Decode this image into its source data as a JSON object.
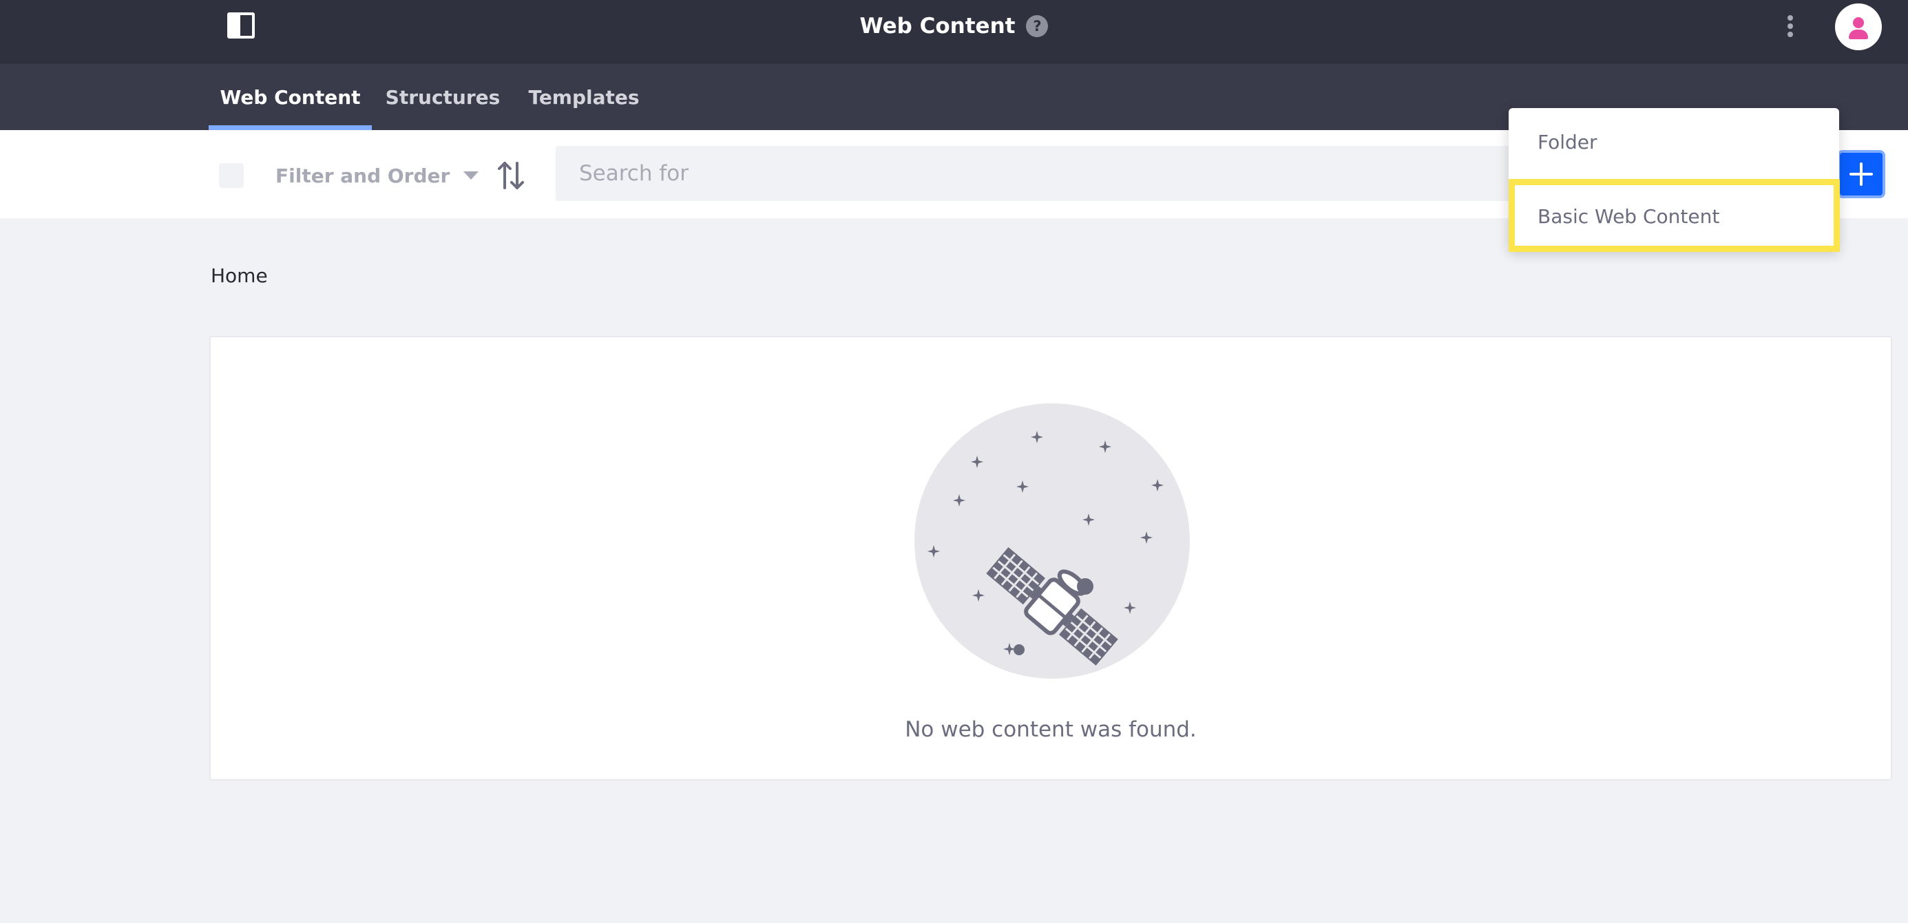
{
  "header": {
    "title": "Web Content",
    "help_glyph": "?",
    "sidebar_toggle_icon": "sidebar-toggle-icon",
    "options_icon": "kebab-menu-icon",
    "avatar_icon": "user-avatar-icon",
    "avatar_color": "#e84ba0",
    "background_color": "#30313f"
  },
  "nav": {
    "tabs": [
      {
        "label": "Web Content",
        "active": true
      },
      {
        "label": "Structures",
        "active": false
      },
      {
        "label": "Templates",
        "active": false
      }
    ],
    "active_indicator_color": "#80acff"
  },
  "toolbar": {
    "filter_label": "Filter and Order",
    "search_placeholder": "Search for",
    "add_button_glyph": "+",
    "add_button_color": "#0b5fff"
  },
  "breadcrumb": {
    "label": "Home"
  },
  "empty_state": {
    "illustration": "satellite-illustration",
    "message": "No web content was found."
  },
  "dropdown": {
    "items": [
      {
        "label": "Folder"
      },
      {
        "label": "Basic Web Content",
        "highlighted": true
      }
    ],
    "highlight_color": "#fbe44c"
  }
}
